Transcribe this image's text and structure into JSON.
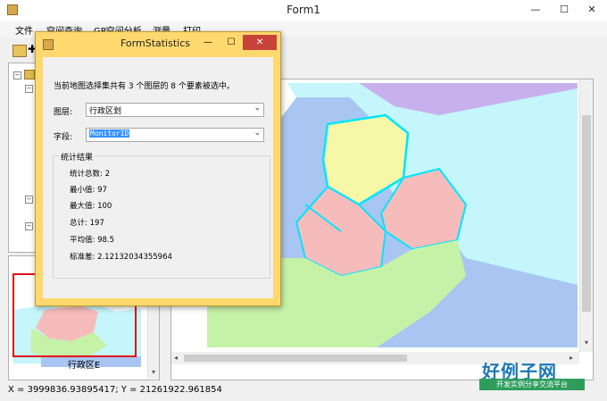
{
  "main_window": {
    "title": "Form1",
    "controls": {
      "minimize": "—",
      "maximize": "☐",
      "close": "✕"
    }
  },
  "menu": [
    "文件",
    "空间查询",
    "GP空间分析",
    "测量",
    "打印"
  ],
  "overview": {
    "label": "行政区E"
  },
  "status": {
    "coords": "X = 3999836.93895417;  Y = 21261922.961854"
  },
  "dialog": {
    "title": "FormStatistics",
    "summary": "当前地图选择集共有 3 个图层的 8 个要素被选中。",
    "layer_label": "图层:",
    "layer_value": "行政区划",
    "field_label": "字段:",
    "field_value": "MonitorID",
    "group_title": "统计结果",
    "stats": [
      "统计总数:  2",
      "最小值: 97",
      "最大值: 100",
      "总计:  197",
      "平均值:  98.5",
      "标准差:  2.12132034355964"
    ],
    "controls": {
      "minimize": "—",
      "maximize": "☐",
      "close": "✕"
    }
  },
  "watermark": {
    "logo": "好例子网",
    "tagline": "开发实例分享交流平台"
  },
  "colors": {
    "dialog_frame": "#ffd86e",
    "close_button": "#c7433a",
    "selection": "#00e5ff",
    "region_yellow": "#f7f7a8",
    "region_pink": "#f6bcbc",
    "region_green": "#c6f2a8",
    "region_purple": "#c8b0ee",
    "region_cyan": "#c4f6fb",
    "region_blue": "#a9c6f2"
  }
}
